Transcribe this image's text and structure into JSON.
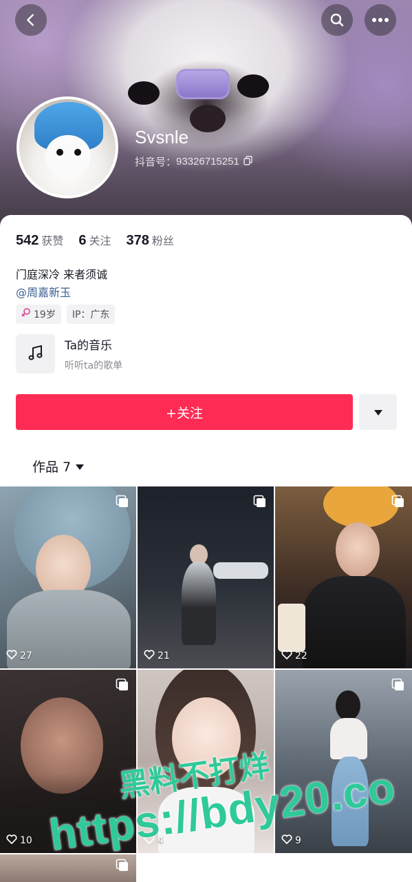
{
  "header": {
    "back_icon": "chevron-left-icon",
    "search_icon": "search-icon",
    "more_icon": "more-horizontal-icon"
  },
  "profile": {
    "name": "Svsnle",
    "douyin_id_label": "抖音号：",
    "douyin_id": "93326715251",
    "copy_icon": "copy-icon"
  },
  "stats": [
    {
      "value": "542",
      "label": "获赞"
    },
    {
      "value": "6",
      "label": "关注"
    },
    {
      "value": "378",
      "label": "粉丝"
    }
  ],
  "bio": {
    "text": "门庭深冷 来者须诚",
    "mention": "@周嘉新玉"
  },
  "tags": {
    "age": "19岁",
    "age_icon": "female-icon",
    "ip": "IP：广东"
  },
  "music": {
    "title": "Ta的音乐",
    "subtitle": "听听ta的歌单",
    "icon": "music-note-icon"
  },
  "actions": {
    "follow_label": "+关注",
    "more_icon": "caret-down-icon"
  },
  "works": {
    "tab_label": "作品 7",
    "tiles": [
      {
        "likes": "27"
      },
      {
        "likes": "21"
      },
      {
        "likes": "22"
      },
      {
        "likes": "10"
      },
      {
        "likes": "4"
      },
      {
        "likes": "9"
      }
    ]
  },
  "watermark": {
    "line1": "黑料不打烊",
    "line2": "https://bdy20.co"
  },
  "colors": {
    "accent": "#fe2c55",
    "mention": "#3d5f8f"
  }
}
